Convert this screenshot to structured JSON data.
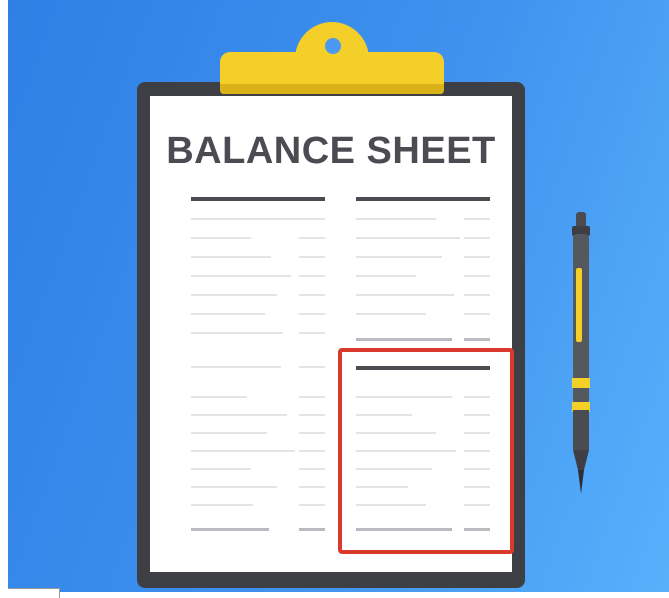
{
  "illustration": {
    "title": "BALANCE SHEET",
    "corner_label": "",
    "colors": {
      "background_start": "#2f7fe6",
      "background_end": "#58b0fb",
      "board": "#3d3f45",
      "paper": "#ffffff",
      "clip": "#f4cf2a",
      "title_text": "#4a4c52",
      "highlight_border": "#d93a2b",
      "pen_body": "#55585f",
      "pen_accent": "#f4cf2a"
    },
    "icons": [
      "clipboard-icon",
      "pen-icon"
    ]
  }
}
